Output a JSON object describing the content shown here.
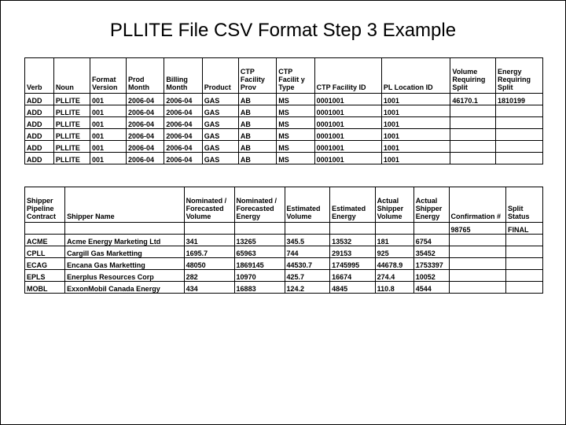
{
  "title": "PLLITE File CSV Format Step 3 Example",
  "table1": {
    "headers": [
      "Verb",
      "Noun",
      "Format Version",
      "Prod Month",
      "Billing Month",
      "Product",
      "CTP Facility Prov",
      "CTP Facilit y Type",
      "CTP Facility ID",
      "PL Location ID",
      "Volume Requiring Split",
      "Energy Requiring Split"
    ],
    "rows": [
      [
        "ADD",
        "PLLITE",
        "001",
        "2006-04",
        "2006-04",
        "GAS",
        "AB",
        "MS",
        "0001001",
        "1001",
        "46170.1",
        "1810199"
      ],
      [
        "ADD",
        "PLLITE",
        "001",
        "2006-04",
        "2006-04",
        "GAS",
        "AB",
        "MS",
        "0001001",
        "1001",
        "",
        ""
      ],
      [
        "ADD",
        "PLLITE",
        "001",
        "2006-04",
        "2006-04",
        "GAS",
        "AB",
        "MS",
        "0001001",
        "1001",
        "",
        ""
      ],
      [
        "ADD",
        "PLLITE",
        "001",
        "2006-04",
        "2006-04",
        "GAS",
        "AB",
        "MS",
        "0001001",
        "1001",
        "",
        ""
      ],
      [
        "ADD",
        "PLLITE",
        "001",
        "2006-04",
        "2006-04",
        "GAS",
        "AB",
        "MS",
        "0001001",
        "1001",
        "",
        ""
      ],
      [
        "ADD",
        "PLLITE",
        "001",
        "2006-04",
        "2006-04",
        "GAS",
        "AB",
        "MS",
        "0001001",
        "1001",
        "",
        ""
      ]
    ],
    "widths": [
      32,
      40,
      40,
      42,
      42,
      40,
      42,
      42,
      74,
      76,
      50,
      52
    ]
  },
  "table2": {
    "headers": [
      "Shipper Pipeline Contract",
      "Shipper  Name",
      "Nominated / Forecasted Volume",
      "Nominated / Forecasted Energy",
      "Estimated Volume",
      "Estimated Energy",
      "Actual Shipper Volume",
      "Actual Shipper Energy",
      "Confirmation #",
      "Split Status"
    ],
    "rowsTop": [
      [
        "",
        "",
        "",
        "",
        "",
        "",
        "",
        "",
        "98765",
        "FINAL"
      ]
    ],
    "rows": [
      [
        "ACME",
        "Acme Energy Marketing Ltd",
        "341",
        "13265",
        "345.5",
        "13532",
        "181",
        "6754",
        "",
        ""
      ],
      [
        "CPLL",
        "Cargill Gas Marketting",
        "1695.7",
        "65963",
        "744",
        "29153",
        "925",
        "35452",
        "",
        ""
      ],
      [
        "ECAG",
        "Encana Gas Marketting",
        "48050",
        "1869145",
        "44530.7",
        "1745995",
        "44678.9",
        "1753397",
        "",
        ""
      ],
      [
        "EPLS",
        "Enerplus Resources Corp",
        "282",
        "10970",
        "425.7",
        "16674",
        "274.4",
        "10052",
        "",
        ""
      ],
      [
        "MOBL",
        "ExxonMobil Canada Energy",
        "434",
        "16883",
        "124.2",
        "4845",
        "110.8",
        "4544",
        "",
        ""
      ]
    ],
    "widths": [
      48,
      142,
      60,
      60,
      54,
      54,
      46,
      42,
      68,
      44
    ]
  }
}
